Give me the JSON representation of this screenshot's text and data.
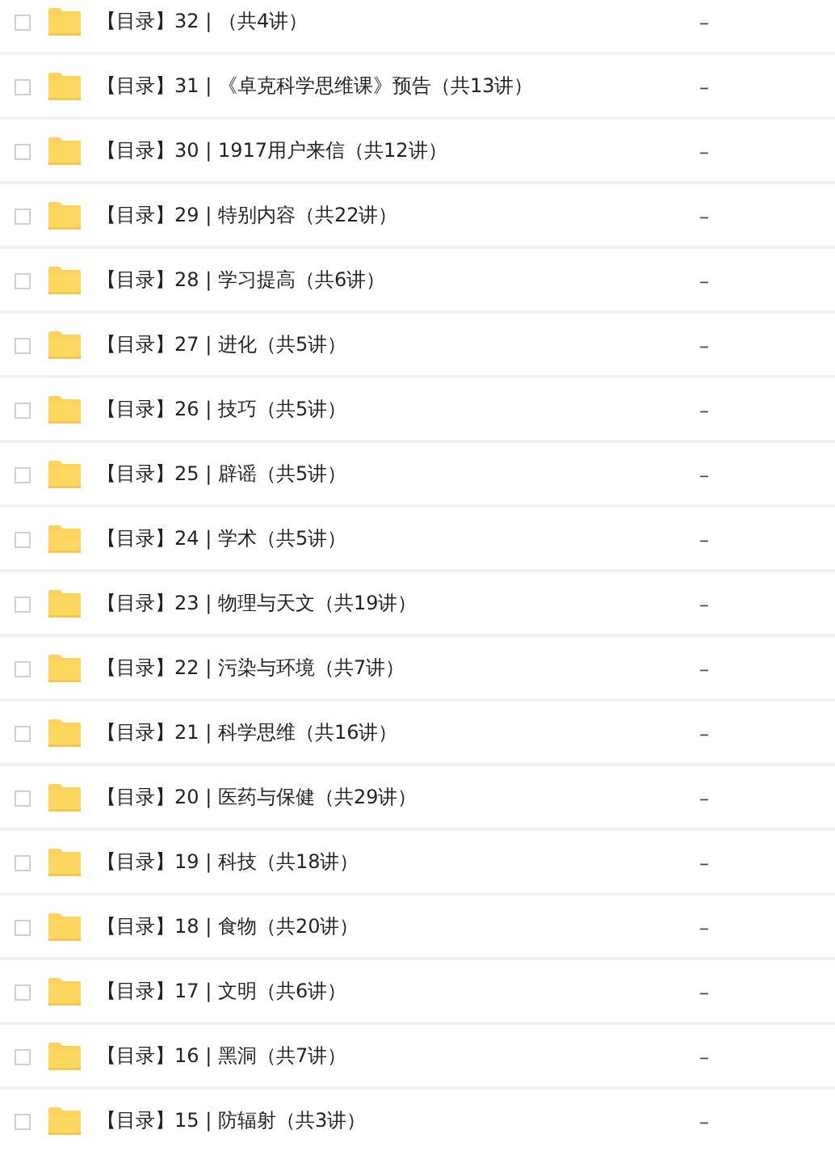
{
  "rows": [
    {
      "name": "【目录】32 | （共4讲）",
      "size": "–",
      "checked": false
    },
    {
      "name": "【目录】31 | 《卓克科学思维课》预告（共13讲）",
      "size": "–",
      "checked": false
    },
    {
      "name": "【目录】30 | 1917用户来信（共12讲）",
      "size": "–",
      "checked": false
    },
    {
      "name": "【目录】29 | 特别内容（共22讲）",
      "size": "–",
      "checked": false
    },
    {
      "name": "【目录】28 | 学习提高（共6讲）",
      "size": "–",
      "checked": false
    },
    {
      "name": "【目录】27 | 进化（共5讲）",
      "size": "–",
      "checked": false
    },
    {
      "name": "【目录】26 | 技巧（共5讲）",
      "size": "–",
      "checked": false
    },
    {
      "name": "【目录】25 | 辟谣（共5讲）",
      "size": "–",
      "checked": false
    },
    {
      "name": "【目录】24 | 学术（共5讲）",
      "size": "–",
      "checked": false
    },
    {
      "name": "【目录】23 | 物理与天文（共19讲）",
      "size": "–",
      "checked": false
    },
    {
      "name": "【目录】22 | 污染与环境（共7讲）",
      "size": "–",
      "checked": false
    },
    {
      "name": "【目录】21 | 科学思维（共16讲）",
      "size": "–",
      "checked": false
    },
    {
      "name": "【目录】20 | 医药与保健（共29讲）",
      "size": "–",
      "checked": false
    },
    {
      "name": "【目录】19 | 科技（共18讲）",
      "size": "–",
      "checked": false
    },
    {
      "name": "【目录】18 | 食物（共20讲）",
      "size": "–",
      "checked": false
    },
    {
      "name": "【目录】17 | 文明（共6讲）",
      "size": "–",
      "checked": false
    },
    {
      "name": "【目录】16 | 黑洞（共7讲）",
      "size": "–",
      "checked": false
    },
    {
      "name": "【目录】15 | 防辐射（共3讲）",
      "size": "–",
      "checked": false
    }
  ]
}
